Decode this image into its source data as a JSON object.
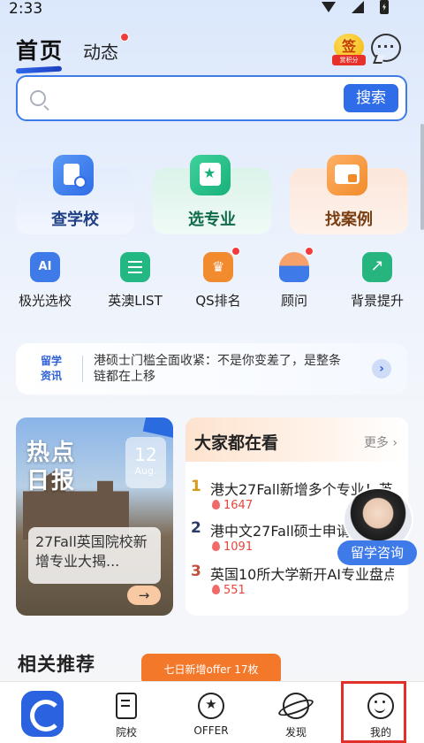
{
  "status_bar": {
    "time": "2:33"
  },
  "header": {
    "tab_home": "首页",
    "tab_feed": "动态",
    "sign_badge": {
      "main": "签",
      "sub": "赏积分"
    }
  },
  "search": {
    "placeholder": "",
    "button": "搜索"
  },
  "main_cards": [
    {
      "label": "查学校",
      "icon": "school-search-icon",
      "color": "#2f6ce8"
    },
    {
      "label": "选专业",
      "icon": "major-book-icon",
      "color": "#18b07a"
    },
    {
      "label": "找案例",
      "icon": "case-folder-icon",
      "color": "#f18b2a"
    }
  ],
  "shortcuts": [
    {
      "label": "极光选校",
      "icon": "ai-robot-icon"
    },
    {
      "label": "英澳LIST",
      "icon": "list-doc-icon"
    },
    {
      "label": "QS排名",
      "icon": "trophy-icon"
    },
    {
      "label": "顾问",
      "icon": "advisor-icon"
    },
    {
      "label": "背景提升",
      "icon": "growth-chart-icon"
    }
  ],
  "news": {
    "tag_line1": "留学",
    "tag_line2": "资讯",
    "text": "港硕士门槛全面收紧：不是你变差了，是整条链都在上移"
  },
  "hot_daily": {
    "title_line1": "热点",
    "title_line2": "日报",
    "day": "12",
    "month": "Aug.",
    "caption": "27Fall英国院校新增专业大揭..."
  },
  "watching": {
    "title": "大家都在看",
    "more": "更多 ›",
    "items": [
      {
        "rank": "1",
        "text": "港大27Fall新增多个专业！英...",
        "heat": "1647"
      },
      {
        "rank": "2",
        "text": "港中文27Fall硕士申请...",
        "heat": "1091"
      },
      {
        "rank": "3",
        "text": "英国10所大学新开AI专业盘点...",
        "heat": "551"
      }
    ]
  },
  "consult": {
    "label": "留学咨询"
  },
  "related": {
    "title": "相关推荐"
  },
  "offer_tip": "七日新增offer 17枚",
  "bottom_nav": [
    {
      "label": "院校",
      "icon": "school-icon"
    },
    {
      "label": "OFFER",
      "icon": "offer-badge-icon"
    },
    {
      "label": "发现",
      "icon": "planet-icon"
    },
    {
      "label": "我的",
      "icon": "smiley-profile-icon"
    }
  ],
  "colors": {
    "accent": "#2f6ce8",
    "highlight": "#e0302a",
    "offer": "#f4782a"
  }
}
